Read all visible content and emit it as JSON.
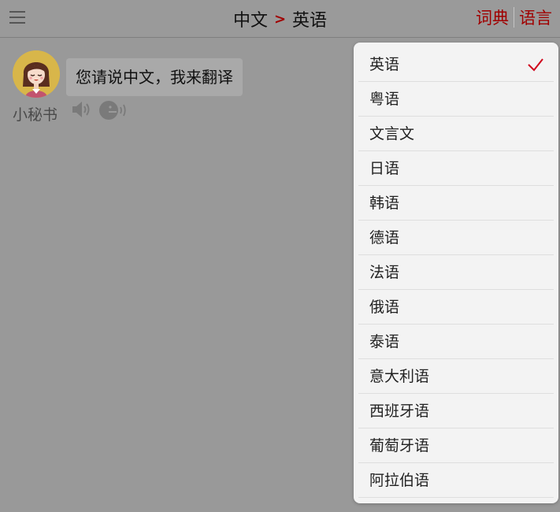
{
  "header": {
    "menu_icon": "hamburger-menu-icon",
    "source_language": "中文",
    "arrow": ">",
    "target_language": "英语",
    "dictionary_label": "词典",
    "language_label": "语言",
    "accent_color": "#a00000"
  },
  "chat": {
    "message": "您请说中文，我来翻译",
    "bot_name": "小秘书",
    "avatar_icon": "girl-avatar-icon",
    "speaker_icon": "speaker-icon",
    "voice_icon": "voice-speaking-icon"
  },
  "language_menu": {
    "selected": "英语",
    "check_color": "#d0021b",
    "items": [
      "英语",
      "粤语",
      "文言文",
      "日语",
      "韩语",
      "德语",
      "法语",
      "俄语",
      "泰语",
      "意大利语",
      "西班牙语",
      "葡萄牙语",
      "阿拉伯语"
    ]
  }
}
